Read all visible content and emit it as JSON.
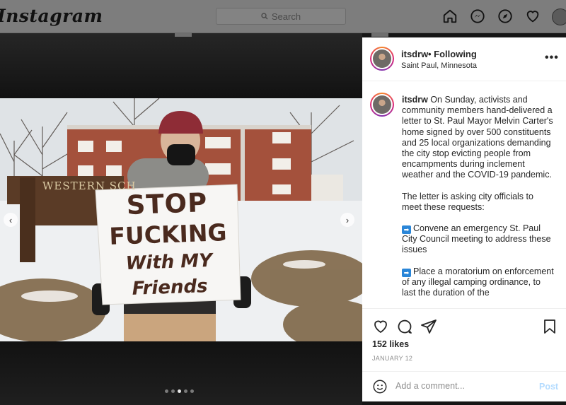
{
  "nav": {
    "logo": "Instagram",
    "search_placeholder": "Search"
  },
  "photo": {
    "sign_line1": "STOP",
    "sign_line2": "FUCKING",
    "sign_line3": "With MY Friends",
    "school_sign": "WESTERN SCH"
  },
  "post": {
    "username": "itsdrw",
    "follow_status": "• Following",
    "location": "Saint Paul, Minnesota",
    "more_label": "•••",
    "caption_p1": "On Sunday, activists and community members hand-delivered a letter to St. Paul Mayor Melvin Carter's home signed by over 500 constituents and 25 local organizations demanding the city stop evicting people from encampments during inclement weather and the COVID-19 pandemic.",
    "caption_p2": "The letter is asking city officials to meet these requests:",
    "caption_p3": "Convene an emergency St. Paul City Council meeting to address these issues",
    "caption_p4": "Place a moratorium on enforcement of any illegal camping ordinance, to last the duration of the",
    "arrow_glyph": "➡",
    "likes": "152 likes",
    "date": "JANUARY 12",
    "comment_placeholder": "Add a comment...",
    "post_label": "Post"
  },
  "carousel": {
    "prev_glyph": "‹",
    "next_glyph": "›",
    "dot_count": 5,
    "active_dot": 3
  },
  "colors": {
    "link_blue": "#0095f6",
    "post_disabled": "#b3dbff"
  }
}
